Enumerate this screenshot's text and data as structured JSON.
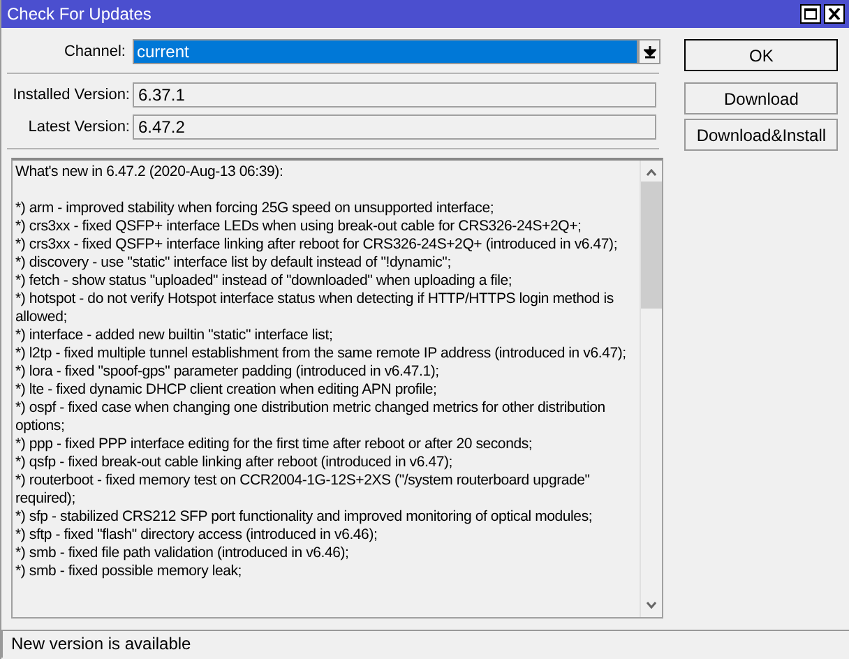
{
  "window": {
    "title": "Check For Updates"
  },
  "channel": {
    "label": "Channel:",
    "value": "current"
  },
  "fields": [
    {
      "label": "Installed Version:",
      "value": "6.37.1"
    },
    {
      "label": "Latest Version:",
      "value": "6.47.2"
    }
  ],
  "buttons": [
    {
      "label": "OK",
      "default": true
    },
    {
      "label": "Download",
      "default": false
    },
    {
      "label": "Download&Install",
      "default": false
    }
  ],
  "notes": {
    "heading": "What's new in 6.47.2 (2020-Aug-13 06:39):",
    "entries": [
      "*) arm - improved stability when forcing 25G speed on unsupported interface;",
      "*) crs3xx - fixed QSFP+ interface LEDs when using break-out cable for CRS326-24S+2Q+;",
      "*) crs3xx - fixed QSFP+ interface linking after reboot for CRS326-24S+2Q+ (introduced in v6.47);",
      "*) discovery - use \"static\" interface list by default instead of \"!dynamic\";",
      "*) fetch - show status \"uploaded\" instead of \"downloaded\" when uploading a file;",
      "*) hotspot - do not verify Hotspot interface status when detecting if HTTP/HTTPS login method is allowed;",
      "*) interface - added new builtin \"static\" interface list;",
      "*) l2tp - fixed multiple tunnel establishment from the same remote IP address (introduced in v6.47);",
      "*) lora - fixed \"spoof-gps\" parameter padding (introduced in v6.47.1);",
      "*) lte - fixed dynamic DHCP client creation when editing APN profile;",
      "*) ospf - fixed case when changing one distribution metric changed metrics for other distribution options;",
      "*) ppp - fixed PPP interface editing for the first time after reboot or after 20 seconds;",
      "*) qsfp - fixed break-out cable linking after reboot (introduced in v6.47);",
      "*) routerboot - fixed memory test on CCR2004-1G-12S+2XS (\"/system routerboard upgrade\" required);",
      "*) sfp - stabilized CRS212 SFP port functionality and improved monitoring of optical modules;",
      "*) sftp - fixed \"flash\" directory access (introduced in v6.46);",
      "*) smb - fixed file path validation (introduced in v6.46);",
      "*) smb - fixed possible memory leak;"
    ]
  },
  "status_bar": "New version is available"
}
